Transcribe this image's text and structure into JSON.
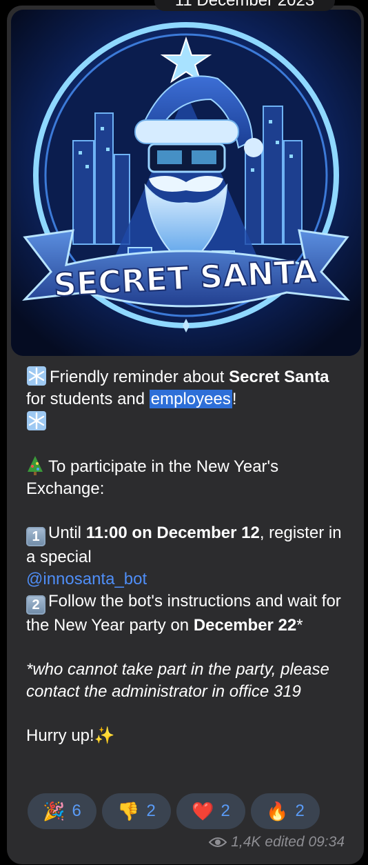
{
  "date_header": "11 December 2023",
  "image": {
    "banner_text": "SECRET SANTA"
  },
  "message": {
    "line1_pre": "Friendly reminder about ",
    "line1_bold": "Secret Santa",
    "line1_mid": " for students and ",
    "line1_selected": "employees",
    "line1_end": "!",
    "participate": "To participate in the New Year's Exchange:",
    "step1_key": "1",
    "step1_pre": "Until ",
    "step1_bold": "11:00 on December 12",
    "step1_post": ", register in a special",
    "bot_link": "@innosanta_bot",
    "step2_key": "2",
    "step2_pre": "Follow the bot's instructions and wait for the New Year party on ",
    "step2_bold": "December 22",
    "step2_post": "*",
    "footnote": "*who cannot take part in the party, please contact the administrator in office 319",
    "hurry": "Hurry up!",
    "hurry_emoji": "✨"
  },
  "reactions": [
    {
      "emoji": "🎉",
      "count": "6"
    },
    {
      "emoji": "👎",
      "count": "2"
    },
    {
      "emoji": "❤️",
      "count": "2"
    },
    {
      "emoji": "🔥",
      "count": "2"
    }
  ],
  "meta": {
    "views": "1,4K",
    "edited": "edited 09:34"
  },
  "colors": {
    "bubble": "#2c2c2e",
    "link": "#4f8ef7",
    "selection": "#2e6fd8",
    "reaction_bg": "#3a4350",
    "meta": "#8e8e93"
  }
}
